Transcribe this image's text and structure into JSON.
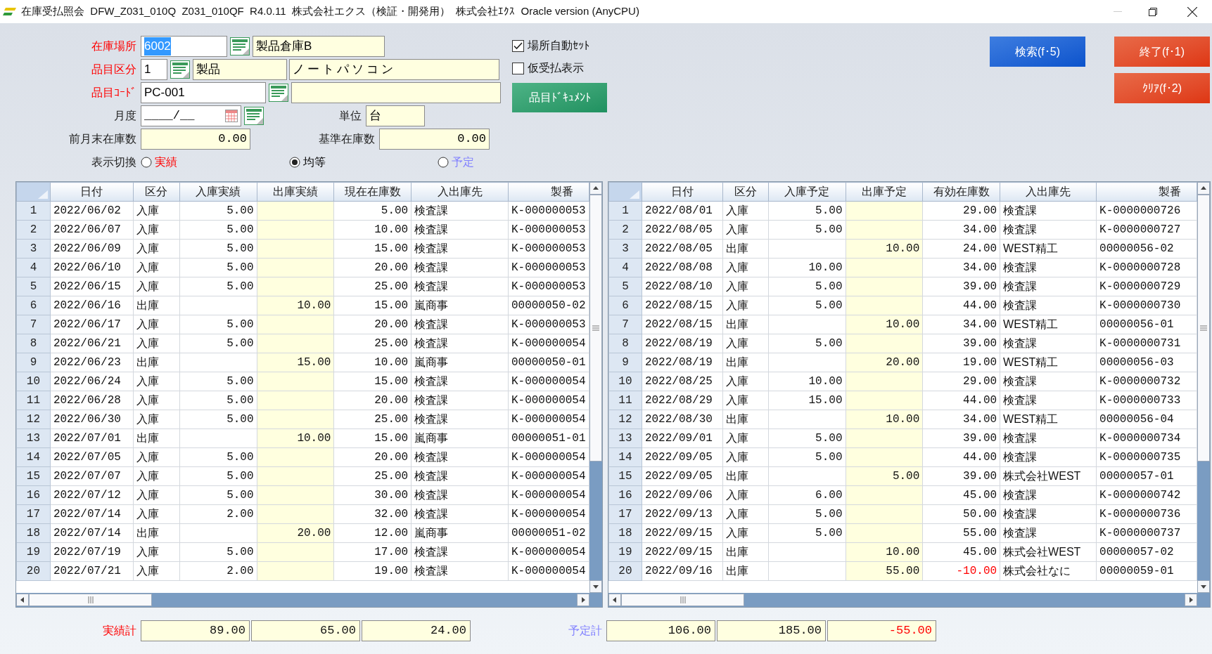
{
  "window": {
    "title": "在庫受払照会  DFW_Z031_010Q  Z031_010QF  R4.0.11  株式会社エクス（検証・開発用）  株式会社ｴｸｽ  Oracle version (AnyCPU)"
  },
  "location": {
    "label": "在庫場所",
    "required": true,
    "code": "6002",
    "focused": true,
    "name": "製品倉庫B"
  },
  "item_class": {
    "label": "品目区分",
    "required": true,
    "code": "1",
    "name": "製品",
    "detail": "ノートパソコン"
  },
  "item_code": {
    "label": "品目ｺｰﾄﾞ",
    "required": true,
    "code": "PC-001"
  },
  "month": {
    "label": "月度",
    "required": false,
    "value": "____/__"
  },
  "unit": {
    "label": "単位",
    "value": "台"
  },
  "prev_stock": {
    "label": "前月末在庫数",
    "value": "0.00"
  },
  "base_stock": {
    "label": "基準在庫数",
    "value": "0.00"
  },
  "display": {
    "label": "表示切換",
    "options": [
      {
        "label": "実績",
        "selected": false,
        "color": "#ff0000"
      },
      {
        "label": "均等",
        "selected": true,
        "color": "#000000"
      },
      {
        "label": "予定",
        "selected": false,
        "color": "#8080ff"
      }
    ]
  },
  "checks": [
    {
      "label": "場所自動ｾｯﾄ",
      "checked": true
    },
    {
      "label": "仮受払表示",
      "checked": false
    }
  ],
  "doc_button": "品目ﾄﾞｷｭﾒﾝﾄ",
  "buttons": [
    {
      "label": "検索(f･5)",
      "kind": "search"
    },
    {
      "label": "終了(f･1)",
      "kind": "exit"
    },
    {
      "label": "ｸﾘｱ(f･2)",
      "kind": "clear"
    }
  ],
  "actual_table": {
    "columns": [
      "日付",
      "区分",
      "入庫実績",
      "出庫実績",
      "現在在庫数",
      "入出庫先",
      "製番"
    ],
    "rows": [
      {
        "no": "1",
        "cells": [
          "2022/06/02",
          "入庫",
          "5.00",
          "",
          "5.00",
          "検査課",
          "K-000000053"
        ]
      },
      {
        "no": "2",
        "cells": [
          "2022/06/07",
          "入庫",
          "5.00",
          "",
          "10.00",
          "検査課",
          "K-000000053"
        ]
      },
      {
        "no": "3",
        "cells": [
          "2022/06/09",
          "入庫",
          "5.00",
          "",
          "15.00",
          "検査課",
          "K-000000053"
        ]
      },
      {
        "no": "4",
        "cells": [
          "2022/06/10",
          "入庫",
          "5.00",
          "",
          "20.00",
          "検査課",
          "K-000000053"
        ]
      },
      {
        "no": "5",
        "cells": [
          "2022/06/15",
          "入庫",
          "5.00",
          "",
          "25.00",
          "検査課",
          "K-000000053"
        ]
      },
      {
        "no": "6",
        "cells": [
          "2022/06/16",
          "出庫",
          "",
          "10.00",
          "15.00",
          "嵐商事",
          "00000050-02"
        ]
      },
      {
        "no": "7",
        "cells": [
          "2022/06/17",
          "入庫",
          "5.00",
          "",
          "20.00",
          "検査課",
          "K-000000053"
        ]
      },
      {
        "no": "8",
        "cells": [
          "2022/06/21",
          "入庫",
          "5.00",
          "",
          "25.00",
          "検査課",
          "K-000000054"
        ]
      },
      {
        "no": "9",
        "cells": [
          "2022/06/23",
          "出庫",
          "",
          "15.00",
          "10.00",
          "嵐商事",
          "00000050-01"
        ]
      },
      {
        "no": "10",
        "cells": [
          "2022/06/24",
          "入庫",
          "5.00",
          "",
          "15.00",
          "検査課",
          "K-000000054"
        ]
      },
      {
        "no": "11",
        "cells": [
          "2022/06/28",
          "入庫",
          "5.00",
          "",
          "20.00",
          "検査課",
          "K-000000054"
        ]
      },
      {
        "no": "12",
        "cells": [
          "2022/06/30",
          "入庫",
          "5.00",
          "",
          "25.00",
          "検査課",
          "K-000000054"
        ]
      },
      {
        "no": "13",
        "cells": [
          "2022/07/01",
          "出庫",
          "",
          "10.00",
          "15.00",
          "嵐商事",
          "00000051-01"
        ]
      },
      {
        "no": "14",
        "cells": [
          "2022/07/05",
          "入庫",
          "5.00",
          "",
          "20.00",
          "検査課",
          "K-000000054"
        ]
      },
      {
        "no": "15",
        "cells": [
          "2022/07/07",
          "入庫",
          "5.00",
          "",
          "25.00",
          "検査課",
          "K-000000054"
        ]
      },
      {
        "no": "16",
        "cells": [
          "2022/07/12",
          "入庫",
          "5.00",
          "",
          "30.00",
          "検査課",
          "K-000000054"
        ]
      },
      {
        "no": "17",
        "cells": [
          "2022/07/14",
          "入庫",
          "2.00",
          "",
          "32.00",
          "検査課",
          "K-000000054"
        ]
      },
      {
        "no": "18",
        "cells": [
          "2022/07/14",
          "出庫",
          "",
          "20.00",
          "12.00",
          "嵐商事",
          "00000051-02"
        ]
      },
      {
        "no": "19",
        "cells": [
          "2022/07/19",
          "入庫",
          "5.00",
          "",
          "17.00",
          "検査課",
          "K-000000054"
        ]
      },
      {
        "no": "20",
        "cells": [
          "2022/07/21",
          "入庫",
          "2.00",
          "",
          "19.00",
          "検査課",
          "K-000000054"
        ]
      }
    ]
  },
  "actual_totals": {
    "label": "実績計",
    "color": "#ff0000",
    "values": [
      {
        "text": "89.00",
        "negative": false
      },
      {
        "text": "65.00",
        "negative": false
      },
      {
        "text": "24.00",
        "negative": false
      }
    ]
  },
  "planned_table": {
    "columns": [
      "日付",
      "区分",
      "入庫予定",
      "出庫予定",
      "有効在庫数",
      "入出庫先",
      "製番"
    ],
    "rows": [
      {
        "no": "1",
        "negative": false,
        "cells": [
          "2022/08/01",
          "入庫",
          "5.00",
          "",
          "29.00",
          "検査課",
          "K-0000000726"
        ]
      },
      {
        "no": "2",
        "negative": false,
        "cells": [
          "2022/08/05",
          "入庫",
          "5.00",
          "",
          "34.00",
          "検査課",
          "K-0000000727"
        ]
      },
      {
        "no": "3",
        "negative": false,
        "cells": [
          "2022/08/05",
          "出庫",
          "",
          "10.00",
          "24.00",
          "WEST精工",
          "00000056-02"
        ]
      },
      {
        "no": "4",
        "negative": false,
        "cells": [
          "2022/08/08",
          "入庫",
          "10.00",
          "",
          "34.00",
          "検査課",
          "K-0000000728"
        ]
      },
      {
        "no": "5",
        "negative": false,
        "cells": [
          "2022/08/10",
          "入庫",
          "5.00",
          "",
          "39.00",
          "検査課",
          "K-0000000729"
        ]
      },
      {
        "no": "6",
        "negative": false,
        "cells": [
          "2022/08/15",
          "入庫",
          "5.00",
          "",
          "44.00",
          "検査課",
          "K-0000000730"
        ]
      },
      {
        "no": "7",
        "negative": false,
        "cells": [
          "2022/08/15",
          "出庫",
          "",
          "10.00",
          "34.00",
          "WEST精工",
          "00000056-01"
        ]
      },
      {
        "no": "8",
        "negative": false,
        "cells": [
          "2022/08/19",
          "入庫",
          "5.00",
          "",
          "39.00",
          "検査課",
          "K-0000000731"
        ]
      },
      {
        "no": "9",
        "negative": false,
        "cells": [
          "2022/08/19",
          "出庫",
          "",
          "20.00",
          "19.00",
          "WEST精工",
          "00000056-03"
        ]
      },
      {
        "no": "10",
        "negative": false,
        "cells": [
          "2022/08/25",
          "入庫",
          "10.00",
          "",
          "29.00",
          "検査課",
          "K-0000000732"
        ]
      },
      {
        "no": "11",
        "negative": false,
        "cells": [
          "2022/08/29",
          "入庫",
          "15.00",
          "",
          "44.00",
          "検査課",
          "K-0000000733"
        ]
      },
      {
        "no": "12",
        "negative": false,
        "cells": [
          "2022/08/30",
          "出庫",
          "",
          "10.00",
          "34.00",
          "WEST精工",
          "00000056-04"
        ]
      },
      {
        "no": "13",
        "negative": false,
        "cells": [
          "2022/09/01",
          "入庫",
          "5.00",
          "",
          "39.00",
          "検査課",
          "K-0000000734"
        ]
      },
      {
        "no": "14",
        "negative": false,
        "cells": [
          "2022/09/05",
          "入庫",
          "5.00",
          "",
          "44.00",
          "検査課",
          "K-0000000735"
        ]
      },
      {
        "no": "15",
        "negative": false,
        "cells": [
          "2022/09/05",
          "出庫",
          "",
          "5.00",
          "39.00",
          "株式会社WEST",
          "00000057-01"
        ]
      },
      {
        "no": "16",
        "negative": false,
        "cells": [
          "2022/09/06",
          "入庫",
          "6.00",
          "",
          "45.00",
          "検査課",
          "K-0000000742"
        ]
      },
      {
        "no": "17",
        "negative": false,
        "cells": [
          "2022/09/13",
          "入庫",
          "5.00",
          "",
          "50.00",
          "検査課",
          "K-0000000736"
        ]
      },
      {
        "no": "18",
        "negative": false,
        "cells": [
          "2022/09/15",
          "入庫",
          "5.00",
          "",
          "55.00",
          "検査課",
          "K-0000000737"
        ]
      },
      {
        "no": "19",
        "negative": false,
        "cells": [
          "2022/09/15",
          "出庫",
          "",
          "10.00",
          "45.00",
          "株式会社WEST",
          "00000057-02"
        ]
      },
      {
        "no": "20",
        "negative": true,
        "cells": [
          "2022/09/16",
          "出庫",
          "",
          "55.00",
          "-10.00",
          "株式会社なに",
          "00000059-01"
        ]
      }
    ]
  },
  "planned_totals": {
    "label": "予定計",
    "color": "#8080ff",
    "values": [
      {
        "text": "106.00",
        "negative": false
      },
      {
        "text": "185.00",
        "negative": false
      },
      {
        "text": "-55.00",
        "negative": true
      }
    ]
  }
}
